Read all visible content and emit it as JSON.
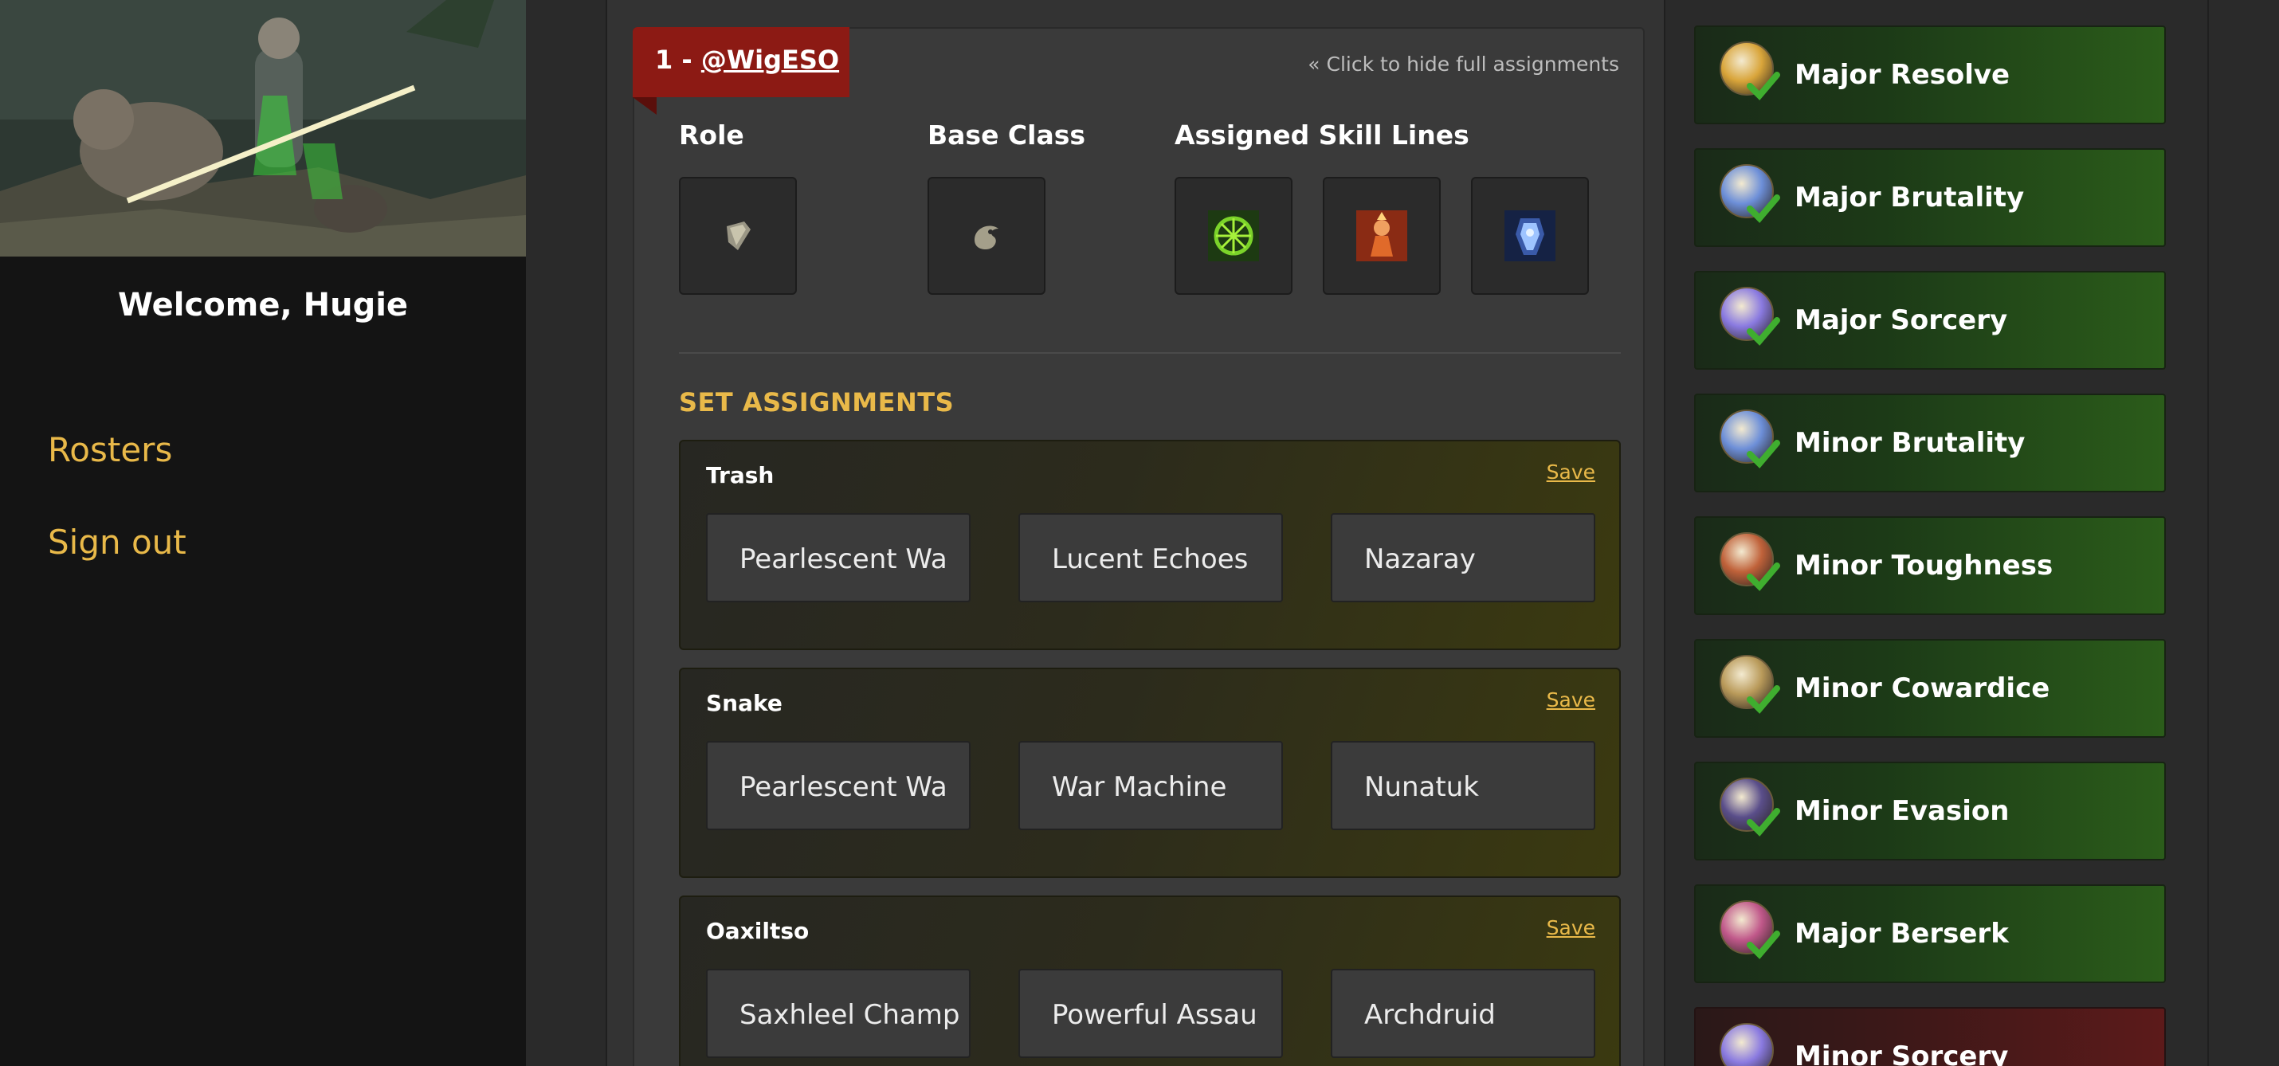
{
  "sidebar": {
    "welcome": "Welcome, Hugie",
    "nav": [
      "Rosters",
      "Sign out"
    ]
  },
  "player": {
    "index_prefix": "1 - ",
    "handle": "@WigESO",
    "hide_link": "« Click to hide full assignments",
    "headers": {
      "role": "Role",
      "base_class": "Base Class",
      "skill_lines": "Assigned Skill Lines"
    },
    "role_icon": "shield-icon",
    "class_icon": "dragon-icon",
    "skill_line_icons": [
      "green-rune-icon",
      "fire-figure-icon",
      "frost-armor-icon"
    ]
  },
  "sets": {
    "title": "SET ASSIGNMENTS",
    "save_label": "Save",
    "blocks": [
      {
        "name": "Trash",
        "values": [
          "Pearlescent Wa",
          "Lucent Echoes",
          "Nazaray"
        ]
      },
      {
        "name": "Snake",
        "values": [
          "Pearlescent Wa",
          "War Machine",
          "Nunatuk"
        ]
      },
      {
        "name": "Oaxiltso",
        "values": [
          "Saxhleel Champ",
          "Powerful Assau",
          "Archdruid"
        ]
      }
    ]
  },
  "buffs": [
    {
      "label": "Major Resolve",
      "status": "assigned",
      "icon": "resolve-icon",
      "color": "#d9a53a"
    },
    {
      "label": "Major Brutality",
      "status": "assigned",
      "icon": "brutality-icon",
      "color": "#6d8fd8"
    },
    {
      "label": "Major Sorcery",
      "status": "assigned",
      "icon": "sorcery-icon",
      "color": "#8a7ae0"
    },
    {
      "label": "Minor Brutality",
      "status": "assigned",
      "icon": "brutality-icon",
      "color": "#6d8fd8"
    },
    {
      "label": "Minor Toughness",
      "status": "assigned",
      "icon": "toughness-icon",
      "color": "#c0623a"
    },
    {
      "label": "Minor Cowardice",
      "status": "assigned",
      "icon": "cowardice-icon",
      "color": "#b99a5a"
    },
    {
      "label": "Minor Evasion",
      "status": "assigned",
      "icon": "evasion-icon",
      "color": "#5a4e8a"
    },
    {
      "label": "Major Berserk",
      "status": "assigned",
      "icon": "berserk-icon",
      "color": "#c0588a"
    },
    {
      "label": "Minor Sorcery",
      "status": "missing",
      "icon": "sorcery-icon",
      "color": "#8a7ae0"
    }
  ],
  "colors": {
    "accent": "#e9b949",
    "flag": "#8c1a14",
    "buff_ok": "#2b5c1a",
    "buff_missing": "#5c1a1a",
    "check": "#3fae2f"
  }
}
